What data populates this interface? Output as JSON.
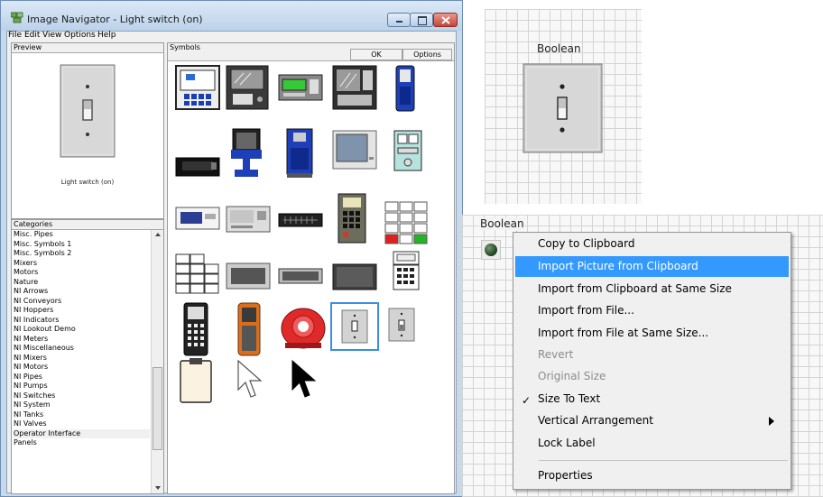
{
  "window": {
    "title": "Image Navigator - Light switch (on)",
    "menu": [
      "File",
      "Edit",
      "View",
      "Options",
      "Help"
    ]
  },
  "preview": {
    "header": "Preview",
    "caption": "Light switch (on)"
  },
  "categories": {
    "header": "Categories",
    "items": [
      "Misc. Pipes",
      "Misc. Symbols 1",
      "Misc. Symbols 2",
      "Mixers",
      "Motors",
      "Nature",
      "NI Arrows",
      "NI Conveyors",
      "NI Hoppers",
      "NI Indicators",
      "NI Lookout Demo",
      "NI Meters",
      "NI Miscellaneous",
      "NI Mixers",
      "NI Motors",
      "NI Pipes",
      "NI Pumps",
      "NI Switches",
      "NI System",
      "NI Tanks",
      "NI Valves",
      "Operator Interface",
      "Panels"
    ],
    "selected": "Operator Interface"
  },
  "symbols": {
    "header": "Symbols",
    "ok_label": "OK",
    "options_label": "Options",
    "selected": "light-switch-on"
  },
  "boolean_control": {
    "label": "Boolean"
  },
  "boolean_indicator": {
    "label": "Boolean"
  },
  "context_menu": {
    "items": [
      {
        "label": "Copy to Clipboard",
        "state": "enabled"
      },
      {
        "label": "Import Picture from Clipboard",
        "state": "highlighted"
      },
      {
        "label": "Import from Clipboard at Same Size",
        "state": "enabled"
      },
      {
        "label": "Import from File...",
        "state": "enabled"
      },
      {
        "label": "Import from File at Same Size...",
        "state": "enabled"
      },
      {
        "label": "Revert",
        "state": "disabled"
      },
      {
        "label": "Original Size",
        "state": "disabled"
      },
      {
        "label": "Size To Text",
        "state": "checked"
      },
      {
        "label": "Vertical Arrangement",
        "state": "submenu"
      },
      {
        "label": "Lock Label",
        "state": "enabled"
      },
      {
        "label": "Properties",
        "state": "enabled"
      }
    ],
    "check_mark": "✓"
  },
  "colors": {
    "highlight": "#3399ff",
    "window_frame": "#c8d9ec",
    "close_button": "#c4443a",
    "selection_border": "#3a8ee6"
  }
}
